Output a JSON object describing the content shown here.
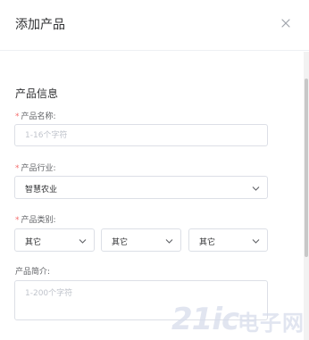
{
  "dialog": {
    "title": "添加产品",
    "close_icon": "close-icon"
  },
  "section": {
    "title": "产品信息"
  },
  "form": {
    "required_mark": "*",
    "name": {
      "label": "产品名称:",
      "placeholder": "1-16个字符",
      "value": ""
    },
    "industry": {
      "label": "产品行业:",
      "value": "智慧农业"
    },
    "category": {
      "label": "产品类别:",
      "selects": [
        "其它",
        "其它",
        "其它"
      ]
    },
    "intro": {
      "label": "产品简介:",
      "placeholder": "1-200个字符",
      "value": ""
    }
  },
  "watermark": {
    "number": "21ic",
    "text": "电子网"
  },
  "colors": {
    "required": "#f56c6c",
    "border": "#dcdfe6",
    "placeholder": "#c0c4cc"
  }
}
